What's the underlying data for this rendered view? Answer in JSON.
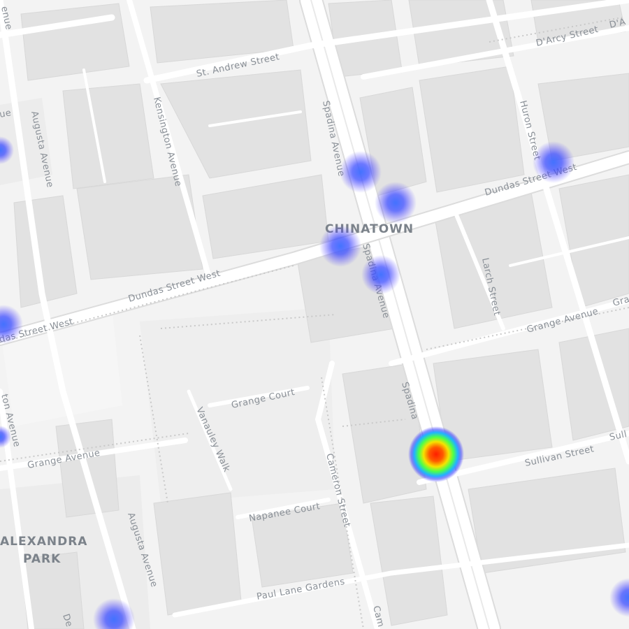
{
  "map": {
    "neighbourhoods": {
      "chinatown": "CHINATOWN",
      "alexandra_park_line1": "ALEXANDRA",
      "alexandra_park_line2": "PARK"
    },
    "streets": {
      "st_andrew": "St. Andrew Street",
      "darcy": "D'Arcy Street",
      "darcy_2": "D'A",
      "kensington": "Kensington Avenue",
      "augusta_north": "Augusta Avenue",
      "augusta_south": "Augusta Avenue",
      "augusta_bottom": "De",
      "augusta_top": "enue",
      "spadina_north": "Spadina Avenue",
      "spadina_mid": "Spadina Avenue",
      "spadina_south": "Spadina",
      "huron": "Huron Street",
      "dundas_east": "Dundas Street West",
      "dundas_west": "Dundas Street West",
      "dundas_far_west": "das Street West",
      "larch": "Larch Street",
      "grange_ave_east": "Grange Avenue",
      "grange_ave_east_2": "Gra",
      "grange_court": "Grange Court",
      "vanauley": "Vanauley Walk",
      "grange_ave_west": "Grange Avenue",
      "cameron": "Cameron Street",
      "napanee": "Napanee Court",
      "sullivan": "Sullivan Street",
      "sullivan_2": "Sull",
      "paul_lane": "Paul Lane Gardens",
      "bathurst_edge": "ton Avenue",
      "left_edge_top": "ue",
      "cameron_bottom": "Cam"
    },
    "heatmap": {
      "colors": [
        "#3b3cff",
        "#00e5ff",
        "#7cff3c",
        "#ffe000",
        "#ff2a00"
      ],
      "hotspots": [
        {
          "name": "hotspot-spadina-sullivan",
          "intensity": 1.0
        },
        {
          "name": "hotspot-spadina-north",
          "intensity": 0.35
        },
        {
          "name": "hotspot-spadina-dundas-ne",
          "intensity": 0.35
        },
        {
          "name": "hotspot-spadina-dundas-nw",
          "intensity": 0.35
        },
        {
          "name": "hotspot-spadina-dundas-s",
          "intensity": 0.35
        },
        {
          "name": "hotspot-huron-dundas",
          "intensity": 0.35
        },
        {
          "name": "hotspot-dundas-west",
          "intensity": 0.3
        },
        {
          "name": "hotspot-augusta-south",
          "intensity": 0.35
        },
        {
          "name": "hotspot-east-edge",
          "intensity": 0.3
        },
        {
          "name": "hotspot-west-edge-top",
          "intensity": 0.25
        },
        {
          "name": "hotspot-west-edge-mid",
          "intensity": 0.25
        }
      ]
    }
  }
}
